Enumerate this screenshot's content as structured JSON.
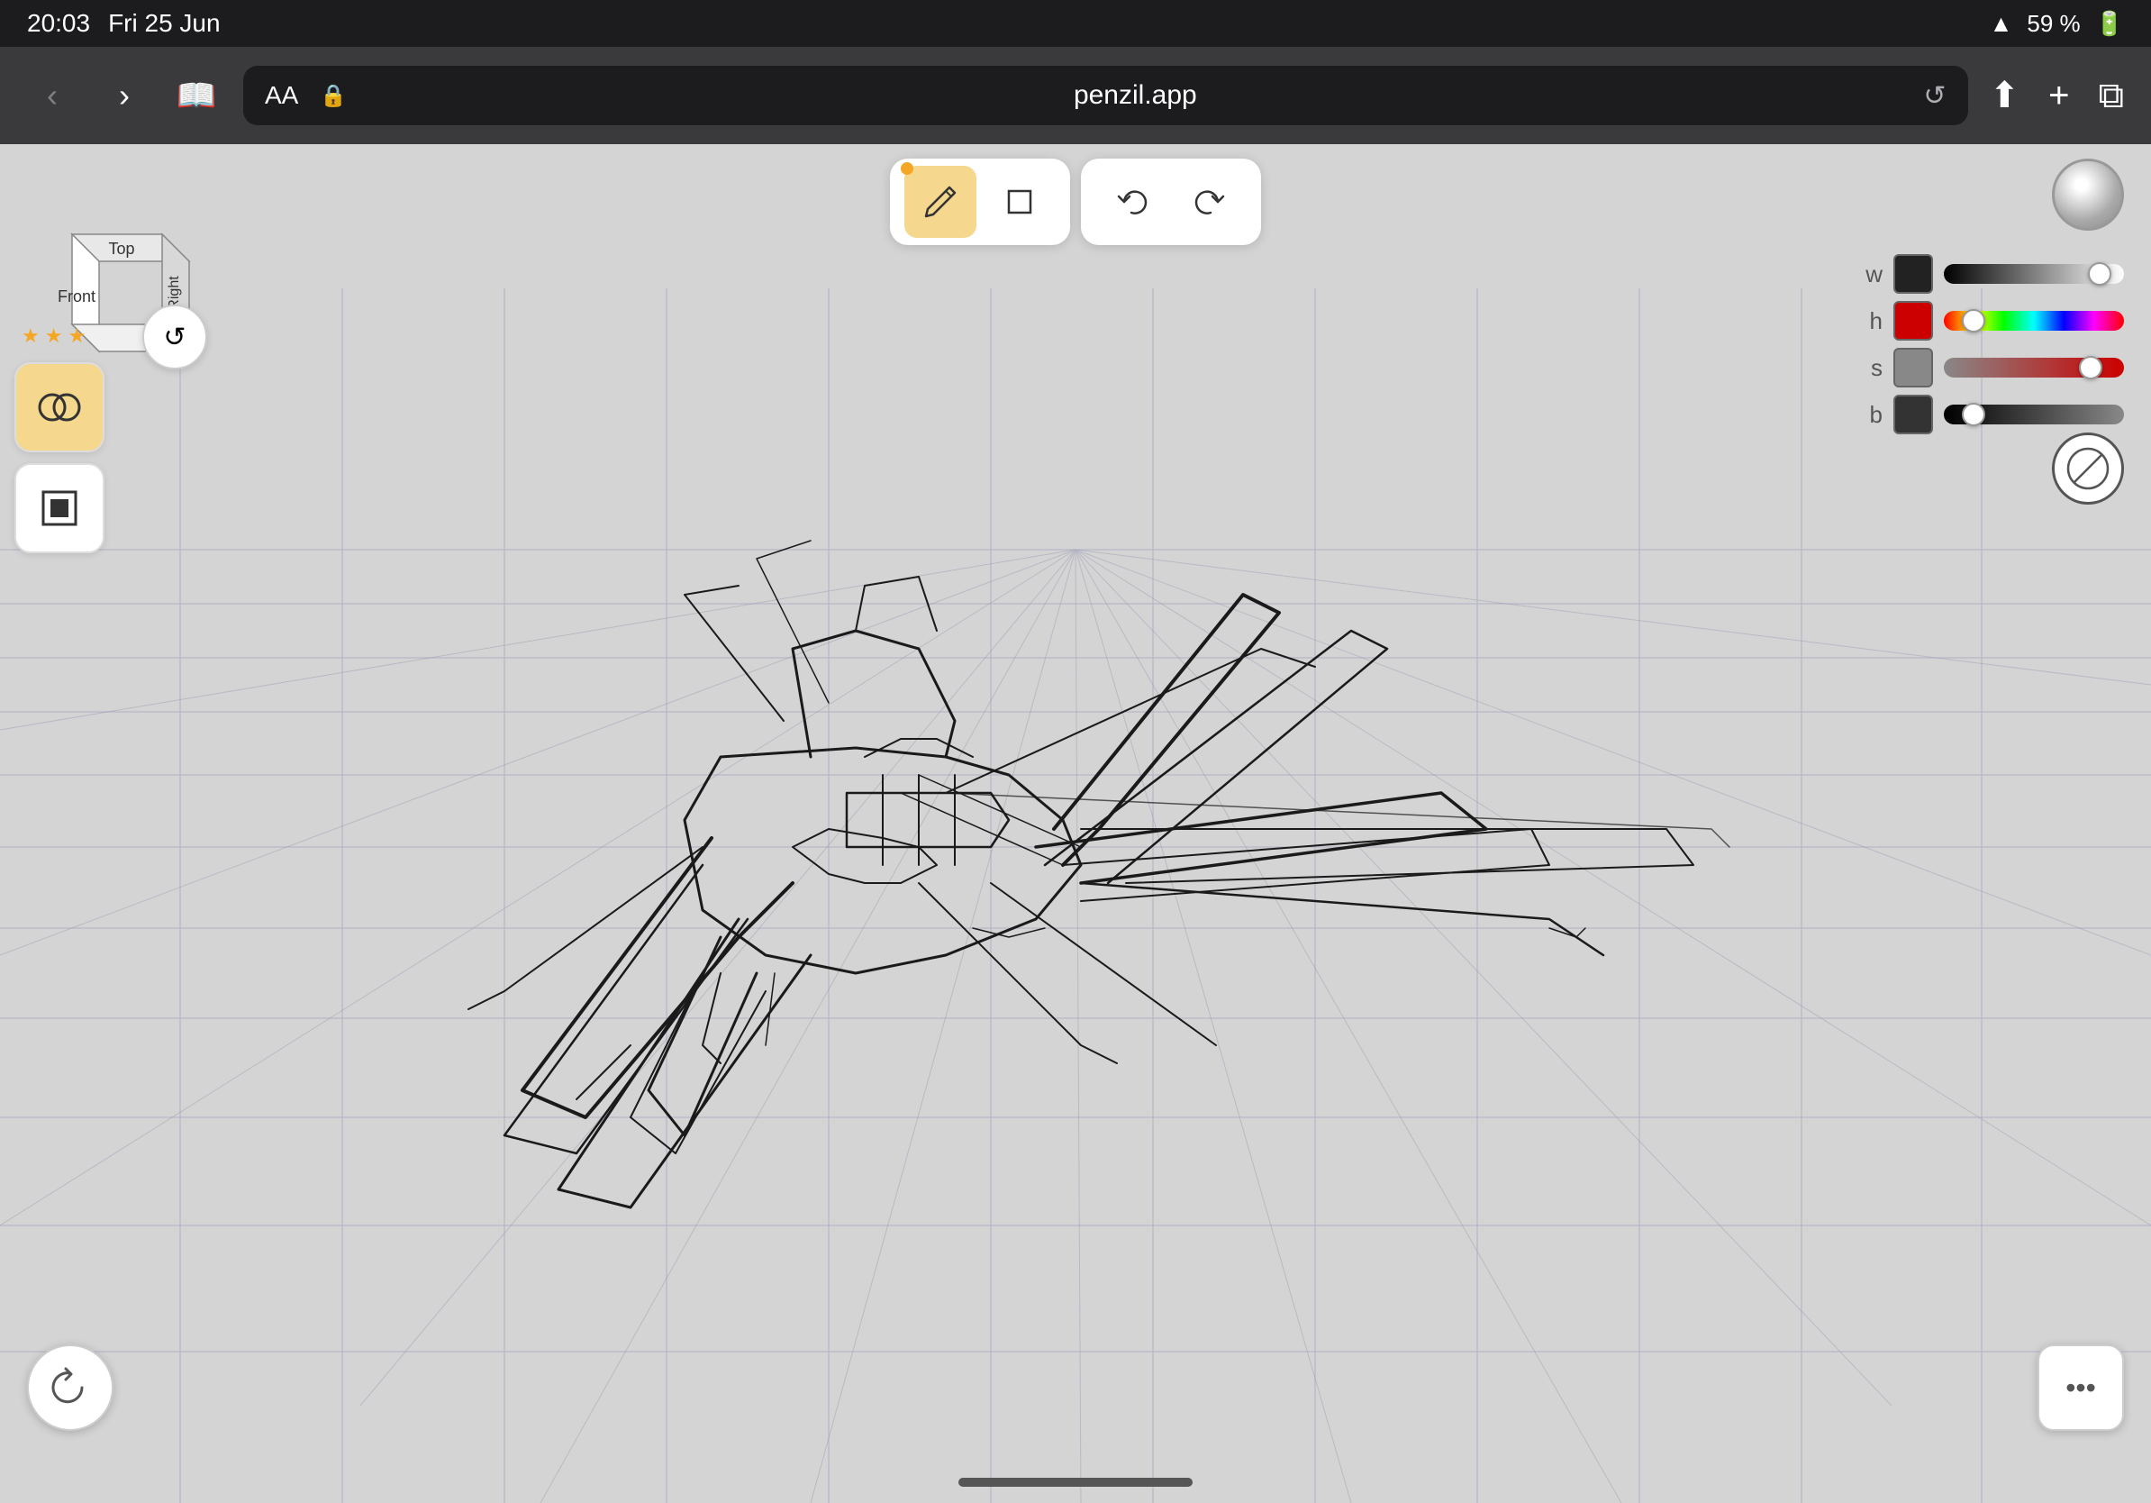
{
  "statusBar": {
    "time": "20:03",
    "date": "Fri 25 Jun",
    "wifi": "wifi",
    "battery": "59 %"
  },
  "browserBar": {
    "aaLabel": "AA",
    "lockIcon": "🔒",
    "url": "penzil.app",
    "reloadIcon": "↺",
    "shareLabel": "share",
    "addLabel": "+",
    "tabsLabel": "tabs"
  },
  "cubeNav": {
    "topFace": "Top",
    "frontFace": "Front",
    "rightFace": "Right",
    "resetIcon": "↺"
  },
  "toolbar": {
    "drawTool": "✏",
    "shapeTool": "□",
    "undoLabel": "↩",
    "redoLabel": "↪"
  },
  "colorPanel": {
    "wLabel": "w",
    "hLabel": "h",
    "sLabel": "s",
    "bLabel": "b",
    "wThumbPos": "85",
    "hThumbPos": "15",
    "sThumbPos": "80",
    "bThumbPos": "15"
  },
  "leftPanel": {
    "stars": [
      "★",
      "★",
      "★"
    ],
    "brushTool": "∞",
    "shapeTool2": "□"
  },
  "bottomButtons": {
    "resetIcon": "↺",
    "moreIcon": "•••"
  }
}
